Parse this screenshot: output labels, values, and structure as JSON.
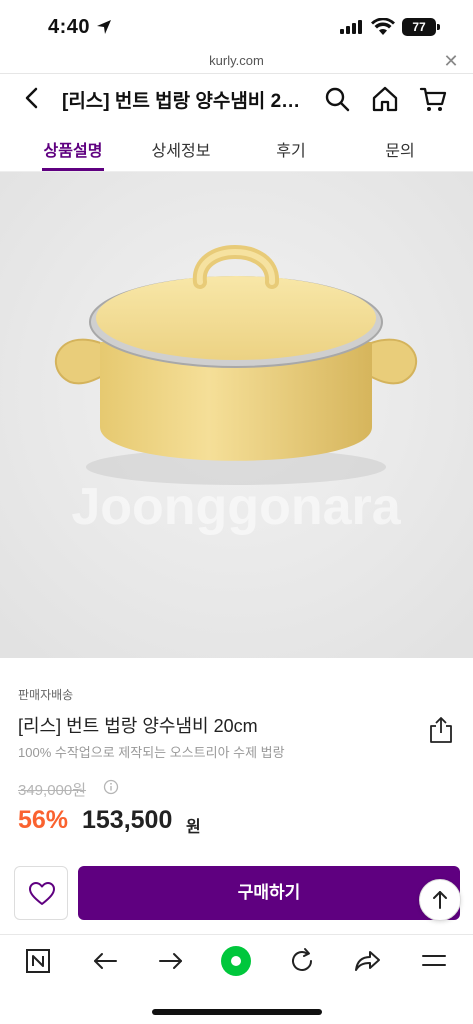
{
  "status": {
    "time": "4:40",
    "battery": "77"
  },
  "browser": {
    "url": "kurly.com"
  },
  "header": {
    "title": "[리스] 번트 법랑 양수냄비 20cm"
  },
  "tabs": [
    {
      "label": "상품설명",
      "active": true
    },
    {
      "label": "상세정보",
      "active": false
    },
    {
      "label": "후기",
      "active": false
    },
    {
      "label": "문의",
      "active": false
    }
  ],
  "image": {
    "watermark": "Joonggonara"
  },
  "product": {
    "seller": "판매자배송",
    "name": "[리스] 번트 법랑 양수냄비 20cm",
    "subtitle": "100% 수작업으로 제작되는 오스트리아 수제 법랑",
    "original_price": "349,000원",
    "discount": "56%",
    "price": "153,500",
    "currency": "원"
  },
  "actions": {
    "buy_label": "구매하기"
  },
  "colors": {
    "brand": "#5f0080",
    "discount": "#fa622f",
    "browser_green": "#00c73c"
  }
}
